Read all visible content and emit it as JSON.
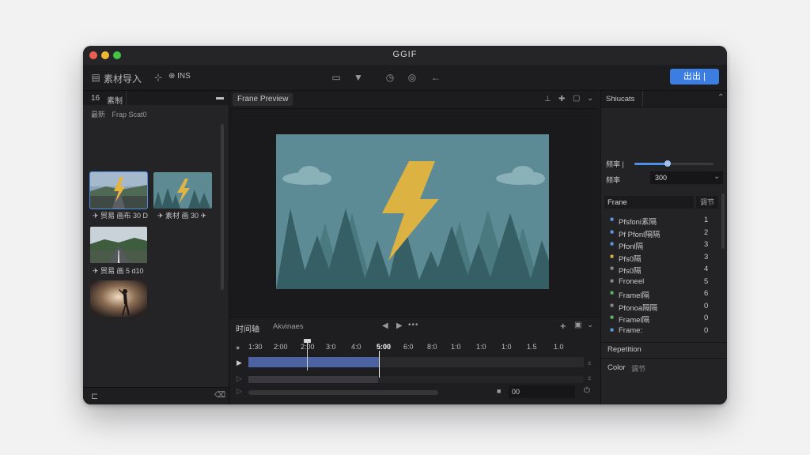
{
  "app": {
    "title": "GGIF"
  },
  "toolbar": {
    "import_label": "素材导入",
    "group2": "⊕ INS",
    "export_label": "出出 |"
  },
  "library": {
    "header_count": "16",
    "header_label": "素制",
    "filter_label": "最新",
    "filter_sub": "Frap Scat0",
    "items": [
      {
        "label": "✈ 贸易 画布 30 D"
      },
      {
        "label": "✈ 素材 画 30 ✈"
      },
      {
        "label": "✈ 贸易 画 5 d10"
      },
      {
        "label": ""
      }
    ]
  },
  "preview": {
    "tab_label": "Frane Preview"
  },
  "timeline": {
    "tab_label": "时间轴",
    "secondary_label": "Akvinaes",
    "ticks": [
      "1:30",
      "2:00",
      "2:00",
      "3:0",
      "4:0",
      "5:00",
      "6:0",
      "8:0",
      "1:0",
      "1:0",
      "1:0",
      "1.5",
      "1.0"
    ],
    "playhead_value": "5:00",
    "time_field": "00"
  },
  "side": {
    "tab_label": "Shiucats",
    "slider_label": "频率 |",
    "slider_fraction": 0.42,
    "select_label": "频率",
    "select_value": "300",
    "frame_tab": "Frane",
    "frame_tab2": "调节",
    "frames": [
      {
        "name": "Pfsfoni素隔",
        "val": "1",
        "color": "#5b9be0"
      },
      {
        "name": "Pf Pfonl隔隔",
        "val": "2",
        "color": "#5b9be0"
      },
      {
        "name": "Pfonl隔",
        "val": "3",
        "color": "#5b9be0"
      },
      {
        "name": "Pfs0隔",
        "val": "3",
        "color": "#d8b14a"
      },
      {
        "name": "Pfs0隔",
        "val": "4",
        "color": "#8a8a8a"
      },
      {
        "name": "Froneel",
        "val": "5",
        "color": "#8a8a8a"
      },
      {
        "name": "Framel隔",
        "val": "6",
        "color": "#5fb86a"
      },
      {
        "name": "Pfonoa隔隔",
        "val": "0",
        "color": "#8a8a8a"
      },
      {
        "name": "Framel隔",
        "val": "0",
        "color": "#5fb86a"
      },
      {
        "name": "Frame:",
        "val": "0",
        "color": "#5b9be0"
      }
    ],
    "repetition_label": "Repetition",
    "color_label": "Color",
    "color_sub": "调节",
    "export_label": "出出"
  }
}
